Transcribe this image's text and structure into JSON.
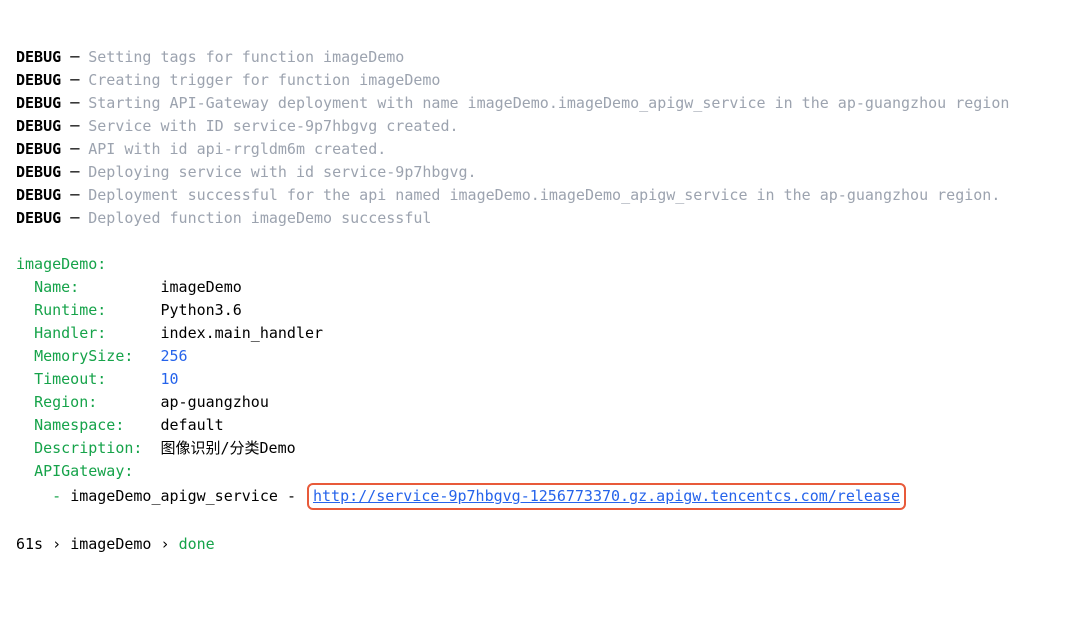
{
  "debug": {
    "label": "DEBUG",
    "dash": "─",
    "lines": [
      "Setting tags for function imageDemo",
      "Creating trigger for function imageDemo",
      "Starting API-Gateway deployment with name imageDemo.imageDemo_apigw_service in the ap-guangzhou region",
      "Service with ID service-9p7hbgvg created.",
      "API with id api-rrgldm6m created.",
      "Deploying service with id service-9p7hbgvg.",
      "Deployment successful for the api named imageDemo.imageDemo_apigw_service in the ap-guangzhou region.",
      "Deployed function imageDemo successful"
    ]
  },
  "output": {
    "header": "imageDemo:",
    "fields": {
      "name": {
        "key": "Name:       ",
        "value": "imageDemo",
        "type": "text"
      },
      "runtime": {
        "key": "Runtime:    ",
        "value": "Python3.6",
        "type": "text"
      },
      "handler": {
        "key": "Handler:    ",
        "value": "index.main_handler",
        "type": "text"
      },
      "memorysize": {
        "key": "MemorySize: ",
        "value": "256",
        "type": "num"
      },
      "timeout": {
        "key": "Timeout:    ",
        "value": "10",
        "type": "num"
      },
      "region": {
        "key": "Region:     ",
        "value": "ap-guangzhou",
        "type": "text"
      },
      "namespace": {
        "key": "Namespace:  ",
        "value": "default",
        "type": "text"
      },
      "description": {
        "key": "Description:",
        "value": "图像识别/分类Demo",
        "type": "text"
      },
      "apigateway": {
        "key": "APIGateway:"
      }
    },
    "apigw": {
      "dash": "-",
      "service_name": "imageDemo_apigw_service",
      "sep": "-",
      "url": "http://service-9p7hbgvg-1256773370.gz.apigw.tencentcs.com/release"
    }
  },
  "prompt": {
    "time": "61s",
    "sep": "›",
    "name": "imageDemo",
    "status": "done"
  }
}
